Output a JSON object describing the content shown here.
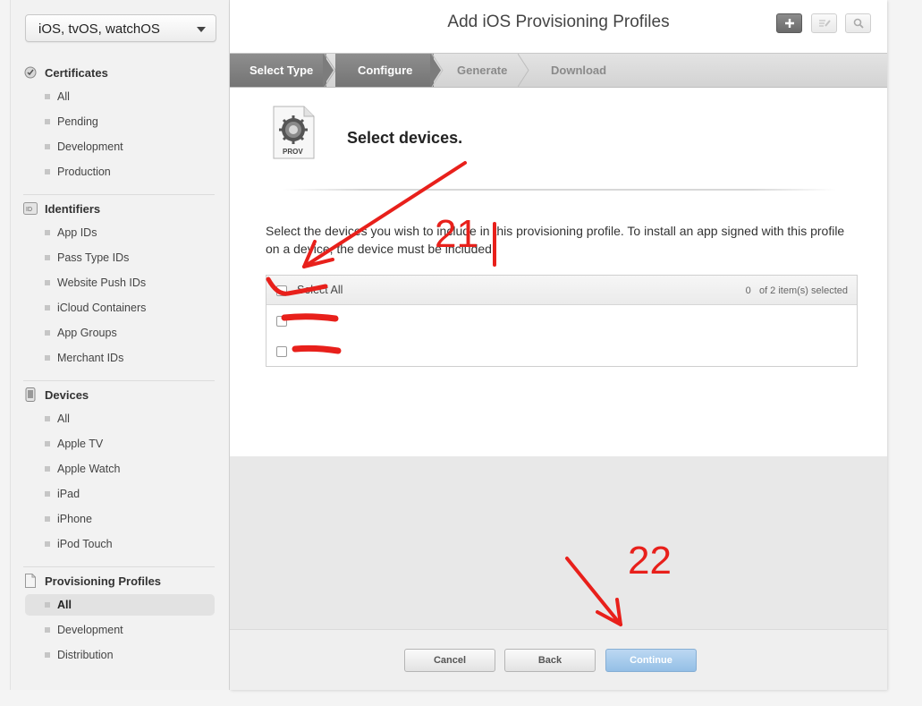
{
  "sidebar": {
    "platform": "iOS, tvOS, watchOS",
    "sections": [
      {
        "title": "Certificates",
        "icon": "certificate-icon",
        "items": [
          "All",
          "Pending",
          "Development",
          "Production"
        ]
      },
      {
        "title": "Identifiers",
        "icon": "id-icon",
        "items": [
          "App IDs",
          "Pass Type IDs",
          "Website Push IDs",
          "iCloud Containers",
          "App Groups",
          "Merchant IDs"
        ]
      },
      {
        "title": "Devices",
        "icon": "device-icon",
        "items": [
          "All",
          "Apple TV",
          "Apple Watch",
          "iPad",
          "iPhone",
          "iPod Touch"
        ]
      },
      {
        "title": "Provisioning Profiles",
        "icon": "document-icon",
        "items": [
          "All",
          "Development",
          "Distribution"
        ]
      }
    ],
    "active_item": "Provisioning Profiles / All"
  },
  "header": {
    "title": "Add iOS Provisioning Profiles",
    "tools": [
      "add-icon",
      "edit-icon",
      "search-icon"
    ]
  },
  "steps": [
    {
      "label": "Select Type",
      "state": "done"
    },
    {
      "label": "Configure",
      "state": "done"
    },
    {
      "label": "Generate",
      "state": "todo"
    },
    {
      "label": "Download",
      "state": "todo"
    }
  ],
  "content": {
    "icon_label": "PROV",
    "title": "Select devices.",
    "instructions": "Select the devices you wish to include in this provisioning profile. To install an app signed with this profile on a device, the device must be included.",
    "table": {
      "select_all_label": "Select All",
      "selected_count": "0",
      "count_suffix": "of 2 item(s) selected",
      "devices": [
        "",
        ""
      ]
    }
  },
  "footer": {
    "cancel": "Cancel",
    "back": "Back",
    "continue": "Continue"
  },
  "annotations": {
    "label_21": "21",
    "label_22": "22",
    "color": "#e8201b"
  },
  "colors": {
    "step_done": "#7f7f7f",
    "continue_button": "#a9cdee",
    "sidebar_bg": "#f2f2f2"
  }
}
